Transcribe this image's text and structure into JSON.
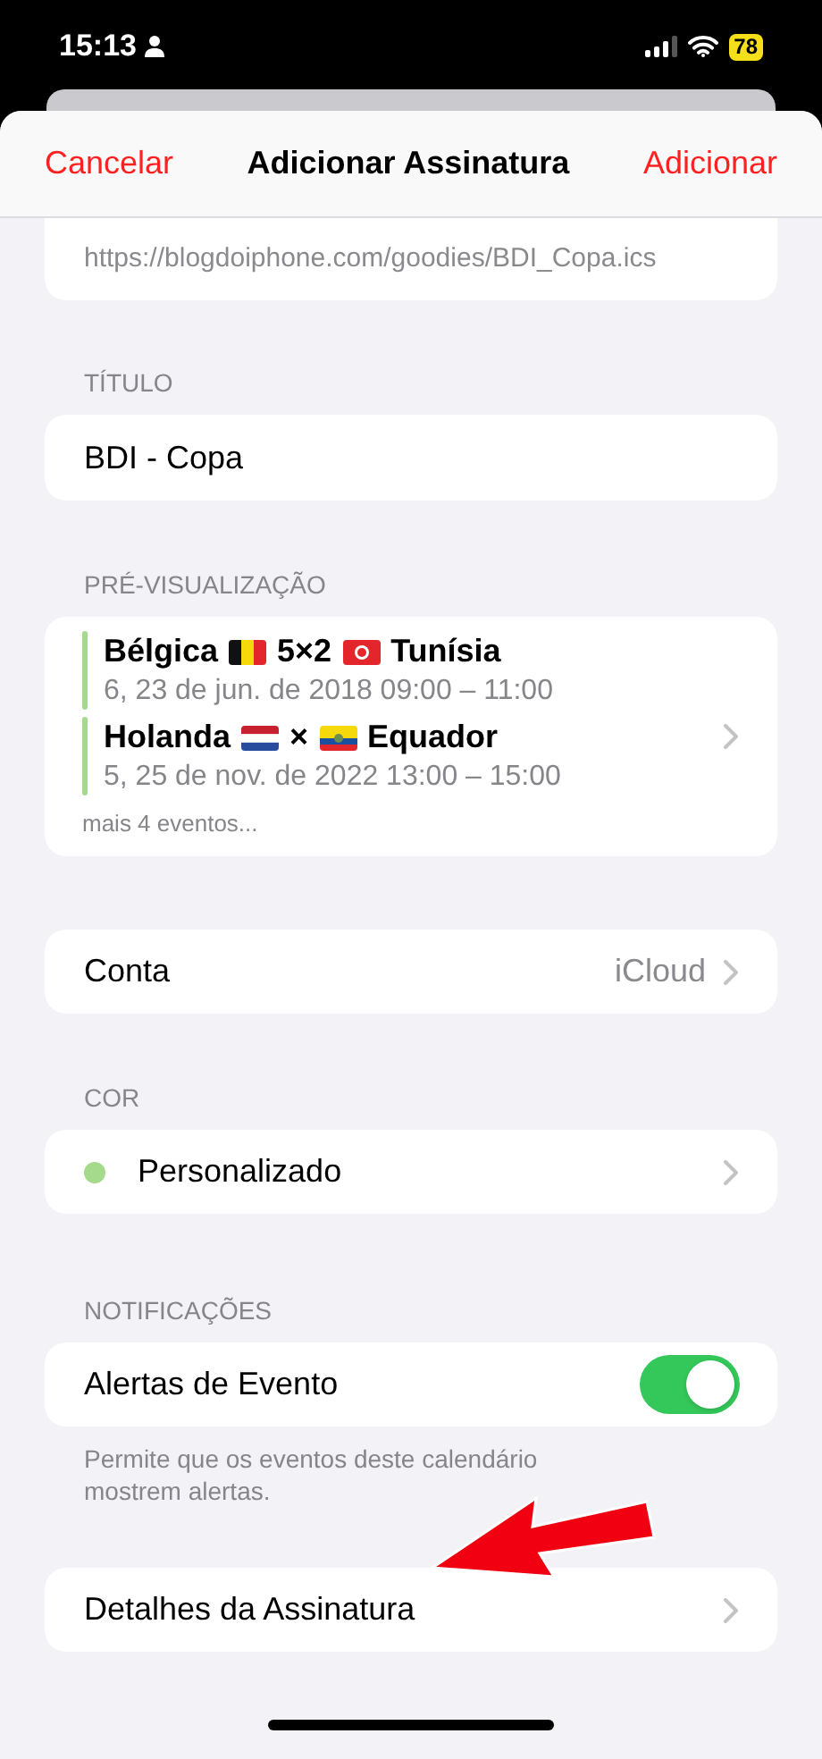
{
  "status_bar": {
    "time": "15:13",
    "battery": "78"
  },
  "nav": {
    "cancel": "Cancelar",
    "title": "Adicionar Assinatura",
    "add": "Adicionar"
  },
  "url": "https://blogdoiphone.com/goodies/BDI_Copa.ics",
  "title_section": {
    "header": "TÍTULO",
    "value": "BDI - Copa"
  },
  "preview": {
    "header": "PRÉ-VISUALIZAÇÃO",
    "color": "#a5d98c",
    "events": [
      {
        "parts": [
          {
            "kind": "text",
            "text": "Bélgica"
          },
          {
            "kind": "belgium"
          },
          {
            "kind": "text",
            "text": "5×2"
          },
          {
            "kind": "tunisia"
          },
          {
            "kind": "text",
            "text": "Tunísia"
          }
        ],
        "when": "6, 23 de jun. de 2018 09:00 – 11:00"
      },
      {
        "parts": [
          {
            "kind": "text",
            "text": "Holanda"
          },
          {
            "kind": "netherlands"
          },
          {
            "kind": "text",
            "text": "×"
          },
          {
            "kind": "ecuador"
          },
          {
            "kind": "text",
            "text": "Equador"
          }
        ],
        "when": "5, 25 de nov. de 2022 13:00 – 15:00"
      }
    ],
    "more": "mais 4 eventos..."
  },
  "account": {
    "label": "Conta",
    "value": "iCloud"
  },
  "color_section": {
    "header": "COR",
    "label": "Personalizado",
    "color": "#a5d98c"
  },
  "notifications": {
    "header": "NOTIFICAÇÕES",
    "label": "Alertas de Evento",
    "on": true,
    "footer": "Permite que os eventos deste calendário mostrem alertas."
  },
  "details": {
    "label": "Detalhes da Assinatura"
  }
}
